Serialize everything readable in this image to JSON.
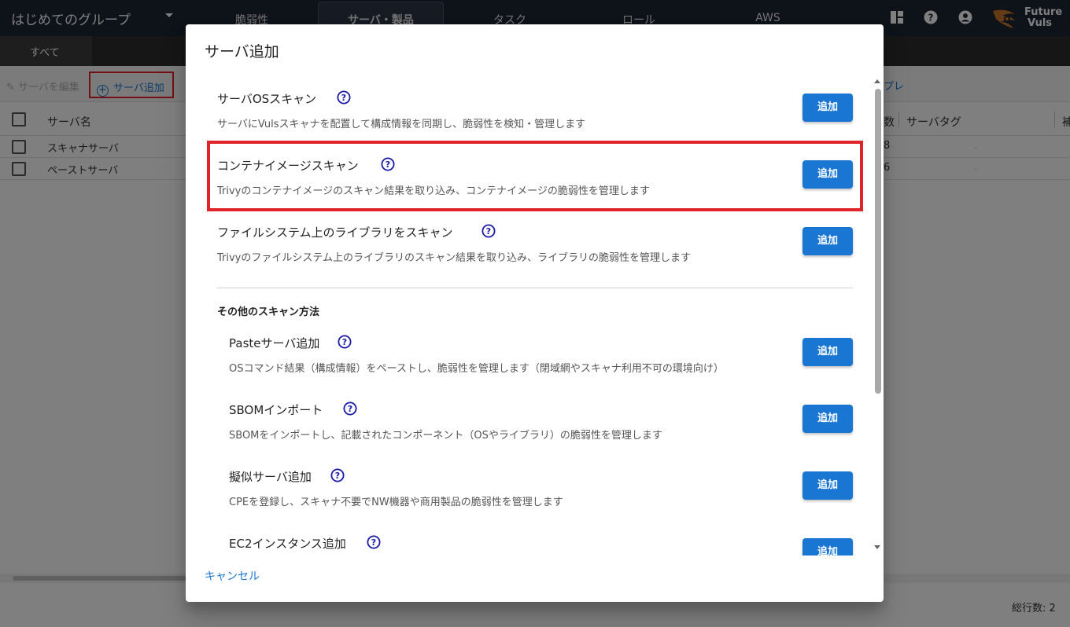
{
  "app": {
    "group_name": "はじめてのグループ",
    "nav_tabs": [
      "脆弱性",
      "サーバ・製品",
      "タスク",
      "ロール",
      "AWS"
    ],
    "logo_line1": "Future",
    "logo_line2": "Vuls",
    "subtab": "すべて"
  },
  "toolbar": {
    "edit_label": "サーバを編集",
    "add_server_label": "サーバ追加",
    "right_fragment": "プレ"
  },
  "table": {
    "headers": {
      "name": "サーバ名",
      "count": "数",
      "tag": "サーバタグ",
      "extra": "補"
    },
    "rows": [
      {
        "name": "スキャナサーバ",
        "count": "8",
        "tag": "-"
      },
      {
        "name": "ペーストサーバ",
        "count": "6",
        "tag": "-"
      }
    ],
    "total": "総行数: 2"
  },
  "dialog": {
    "title": "サーバ追加",
    "add_label": "追加",
    "cancel_label": "キャンセル",
    "other_section": "その他のスキャン方法",
    "options": [
      {
        "title": "サーバOSスキャン",
        "desc": "サーバにVulsスキャナを配置して構成情報を同期し、脆弱性を検知・管理します"
      },
      {
        "title": "コンテナイメージスキャン",
        "desc": "Trivyのコンテナイメージのスキャン結果を取り込み、コンテナイメージの脆弱性を管理します"
      },
      {
        "title": "ファイルシステム上のライブラリをスキャン",
        "desc": "Trivyのファイルシステム上のライブラリのスキャン結果を取り込み、ライブラリの脆弱性を管理します"
      }
    ],
    "other_options": [
      {
        "title": "Pasteサーバ追加",
        "desc": "OSコマンド結果（構成情報）をペーストし、脆弱性を管理します（閉域網やスキャナ利用不可の環境向け）"
      },
      {
        "title": "SBOMインポート",
        "desc": "SBOMをインポートし、記載されたコンポーネント（OSやライブラリ）の脆弱性を管理します"
      },
      {
        "title": "擬似サーバ追加",
        "desc": "CPEを登録し、スキャナ不要でNW機器や商用製品の脆弱性を管理します"
      },
      {
        "title": "EC2インスタンス追加",
        "desc": ""
      }
    ]
  },
  "colors": {
    "accent": "#1976d2",
    "highlight": "#e3232a",
    "topbar": "#1d2432",
    "help_icon": "#1a1aa6"
  }
}
